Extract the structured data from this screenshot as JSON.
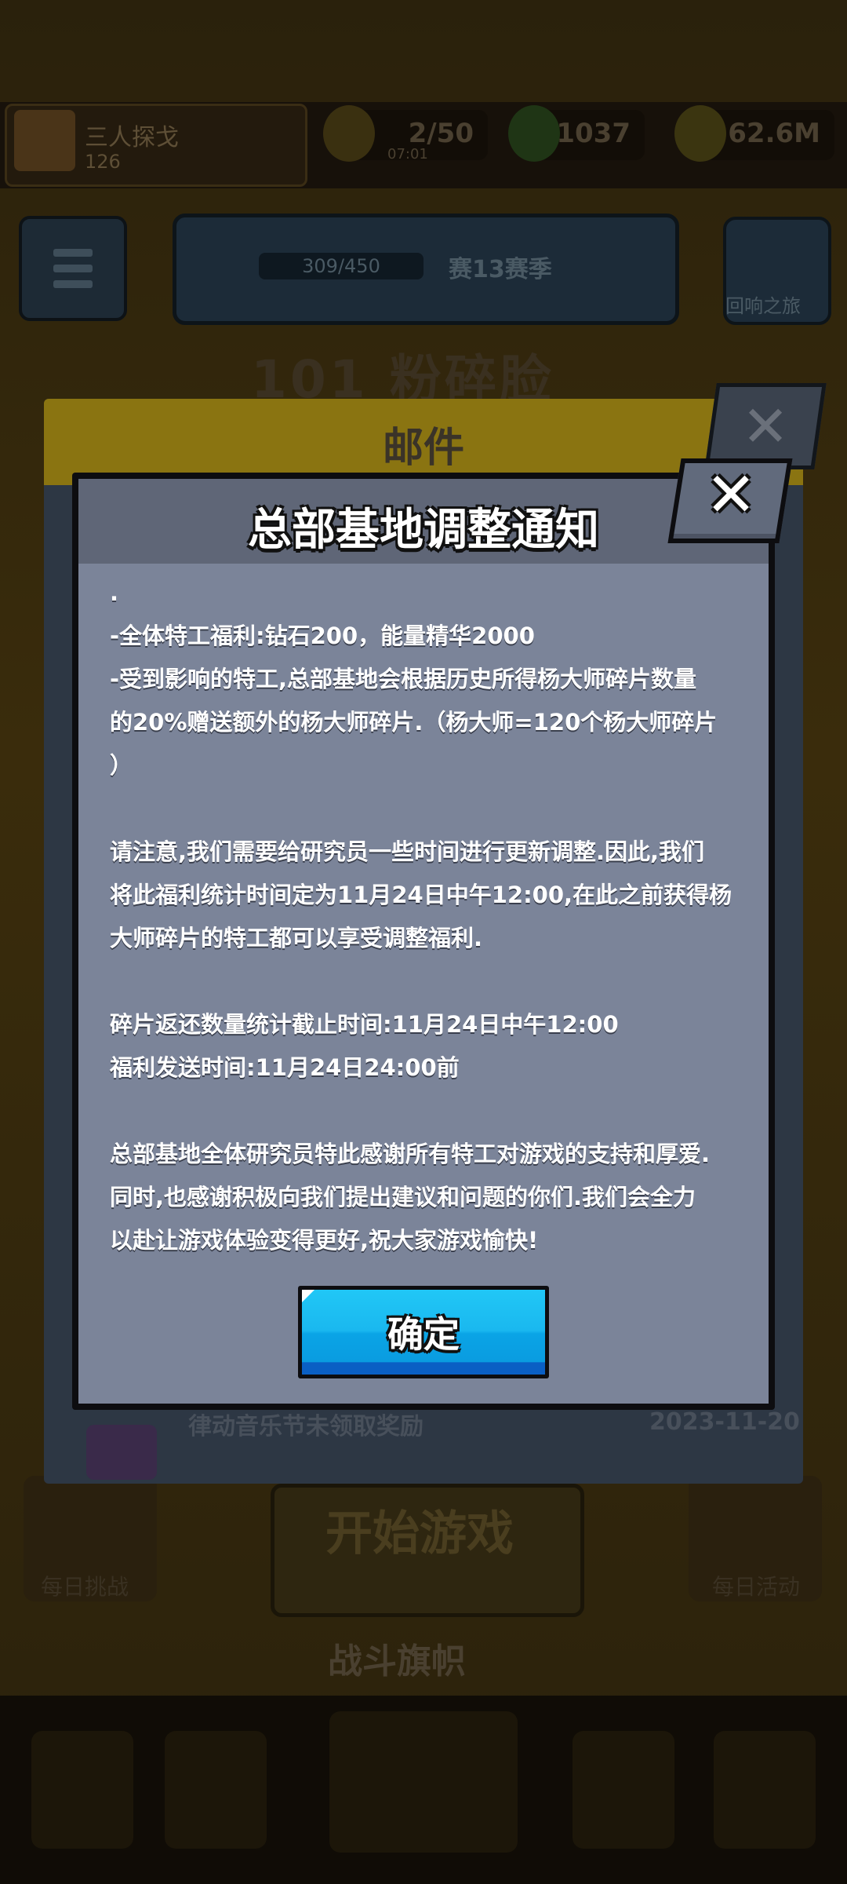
{
  "background": {
    "player": {
      "name": "三人探戈",
      "level": "126"
    },
    "resources": [
      {
        "icon": "energy-icon",
        "value": "2/50",
        "sub": "07:01"
      },
      {
        "icon": "gem-icon",
        "value": "1037",
        "sub": ""
      },
      {
        "icon": "coin-icon",
        "value": "62.6M",
        "sub": ""
      }
    ],
    "rank": {
      "progress": "309/450",
      "label": "赛13赛季"
    },
    "shield_label": "回响之旅",
    "level_title": "101 粉碎脸",
    "start_label": "开始游戏",
    "daily_left": "每日挑战",
    "daily_right": "每日活动",
    "battle_label": "战斗旗帜"
  },
  "mail": {
    "title": "邮件",
    "close_glyph": "✕",
    "last_row": {
      "title": "律动音乐节未领取奖励",
      "date": "2023-11-20"
    }
  },
  "dialog": {
    "title": "总部基地调整通知",
    "close_glyph": "✕",
    "lines": [
      ".",
      "-全体特工福利:钻石200，能量精华2000",
      "-受到影响的特工,总部基地会根据历史所得杨大师碎片数量",
      "的20%赠送额外的杨大师碎片.（杨大师=120个杨大师碎片",
      "）",
      "",
      "请注意,我们需要给研究员一些时间进行更新调整.因此,我们",
      "将此福利统计时间定为11月24日中午12:00,在此之前获得杨",
      "大师碎片的特工都可以享受调整福利.",
      "",
      "碎片返还数量统计截止时间:11月24日中午12:00",
      "福利发送时间:11月24日24:00前",
      "",
      "总部基地全体研究员特此感谢所有特工对游戏的支持和厚爱.",
      "同时,也感谢积极向我们提出建议和问题的你们.我们会全力",
      "以赴让游戏体验变得更好,祝大家游戏愉快!"
    ],
    "ok_label": "确定"
  }
}
